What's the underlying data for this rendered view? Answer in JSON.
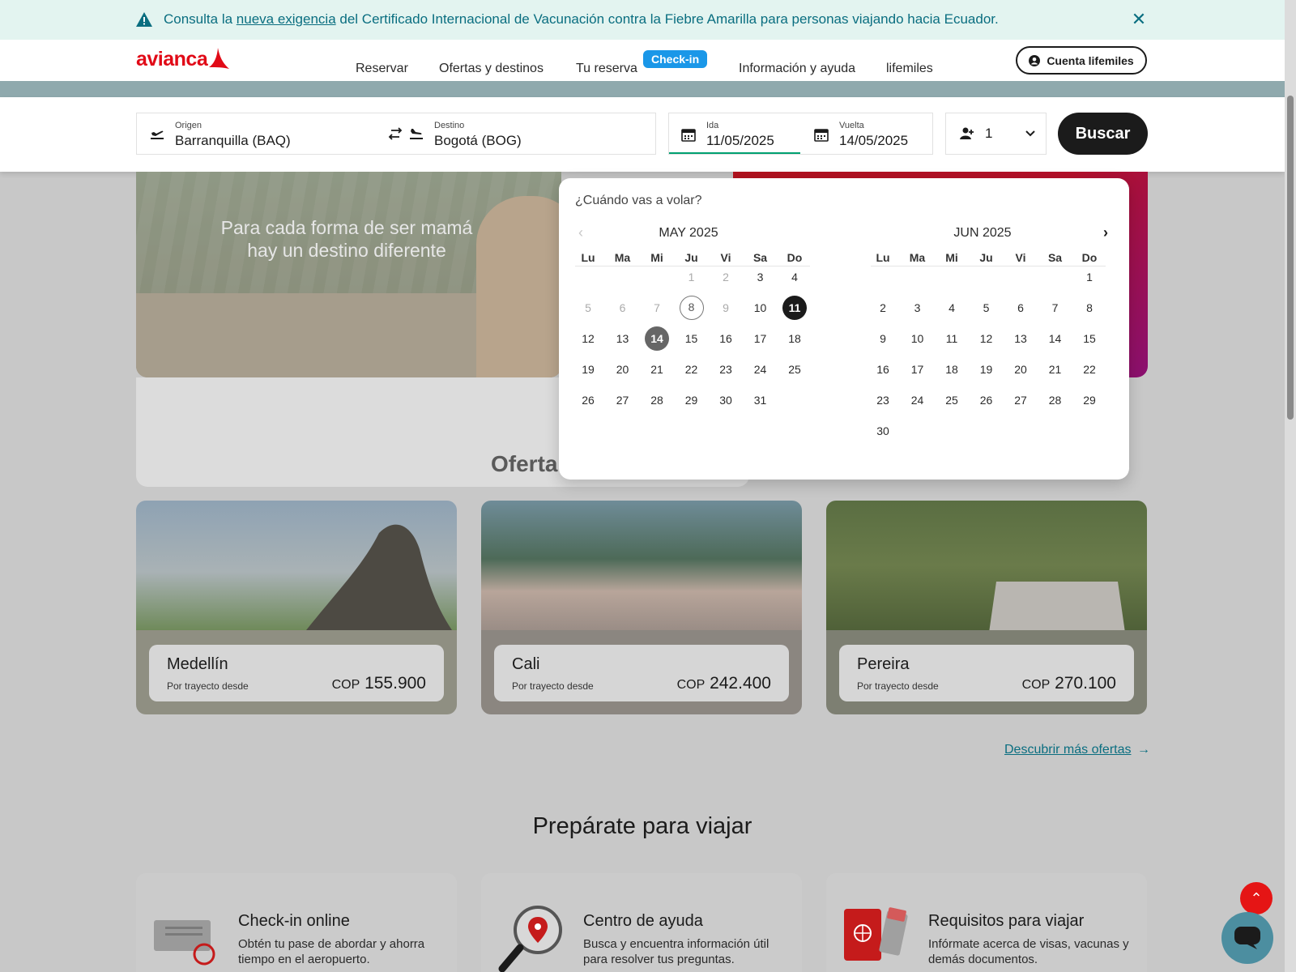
{
  "notice": {
    "text_before": "Consulta la ",
    "link": "nueva exigencia",
    "text_after": " del Certificado Internacional de Vacunación contra la Fiebre Amarilla para personas viajando hacia Ecuador.",
    "close": "✕"
  },
  "header": {
    "logo": "avianca",
    "nav": [
      "Reservar",
      "Ofertas y destinos",
      "Tu reserva",
      "Información y ayuda",
      "lifemiles"
    ],
    "checkin_badge": "Check-in",
    "account_button": "Cuenta lifemiles"
  },
  "search": {
    "origin_label": "Origen",
    "origin_value": "Barranquilla  (BAQ)",
    "destination_label": "Destino",
    "destination_value": "Bogotá  (BOG)",
    "departure_label": "Ida",
    "departure_value": "11/05/2025",
    "return_label": "Vuelta",
    "return_value": "14/05/2025",
    "passengers": "1",
    "search_button": "Buscar"
  },
  "hero": {
    "line1": "Para cada forma de ser mamá",
    "line2": "hay un destino diferente"
  },
  "offers_title": "Oferta",
  "destinations": [
    {
      "city": "Medellín",
      "from": "Por trayecto desde",
      "currency": "COP",
      "price": "155.900"
    },
    {
      "city": "Cali",
      "from": "Por trayecto desde",
      "currency": "COP",
      "price": "242.400"
    },
    {
      "city": "Pereira",
      "from": "Por trayecto desde",
      "currency": "COP",
      "price": "270.100"
    }
  ],
  "more_offers": "Descubrir más ofertas",
  "more_offers_arrow": "→",
  "prepare_title": "Prepárate para viajar",
  "prepare_cards": [
    {
      "title": "Check-in online",
      "desc": "Obtén tu pase de abordar y ahorra tiempo en el aeropuerto."
    },
    {
      "title": "Centro de ayuda",
      "desc": "Busca y encuentra información útil para resolver tus preguntas."
    },
    {
      "title": "Requisitos para viajar",
      "desc": "Infórmate acerca de visas, vacunas y demás documentos."
    }
  ],
  "calendar": {
    "question": "¿Cuándo vas a volar?",
    "weekdays": [
      "Lu",
      "Ma",
      "Mi",
      "Ju",
      "Vi",
      "Sa",
      "Do"
    ],
    "months": [
      {
        "title": "MAY 2025",
        "first_weekday": 3,
        "days": 31,
        "past_until": 9,
        "today": 8,
        "departure": 11,
        "return": 14
      },
      {
        "title": "JUN 2025",
        "first_weekday": 6,
        "days": 30,
        "past_until": 0,
        "today": null,
        "departure": null,
        "return": null
      }
    ],
    "prev_arrow": "‹",
    "next_arrow": "›"
  },
  "scroll_top": "⌃",
  "colors": {
    "brand_red": "#e10a17",
    "notice_teal": "#0a6e80",
    "checkin_blue": "#1a97e8",
    "dark": "#1b1b1b"
  }
}
